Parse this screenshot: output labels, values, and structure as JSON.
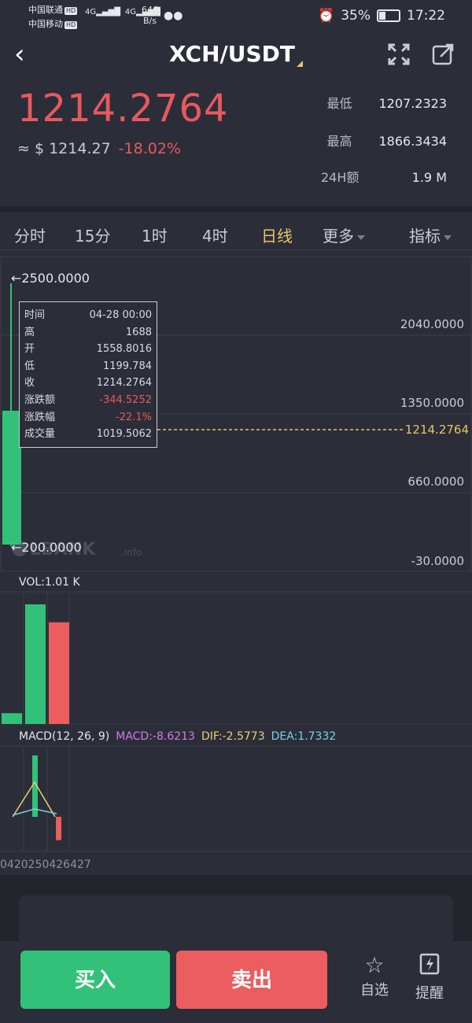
{
  "status": {
    "carrier1": "中国联通",
    "carrier2": "中国移动",
    "hd": "HD",
    "net1": "4G",
    "net2": "4G",
    "speed_value": "646",
    "speed_unit": "B/s",
    "battery_pct": "35%",
    "battery_level": 0.35,
    "time": "17:22"
  },
  "header": {
    "title": "XCH/USDT"
  },
  "price": {
    "last": "1214.2764",
    "approx": "≈ $ 1214.27",
    "change_pct": "-18.02%",
    "low_label": "最低",
    "low": "1207.2323",
    "high_label": "最高",
    "high": "1866.3434",
    "vol24_label": "24H额",
    "vol24": "1.9 M"
  },
  "tabs": [
    "分时",
    "15分",
    "1时",
    "4时",
    "日线",
    "更多",
    "指标"
  ],
  "active_tab": "日线",
  "chart_data": {
    "type": "candlestick",
    "price_axis": {
      "ticks": [
        "2040.0000",
        "1350.0000",
        "660.0000",
        "-30.0000"
      ]
    },
    "high_marker": "←2500.0000",
    "low_marker": "←200.0000",
    "current_price_line": "1214.2764",
    "watermark": "LBANK",
    "watermark_suffix": ".info",
    "candles": [
      {
        "date": "04-28",
        "open": 1558.8016,
        "high": 2500,
        "low": 200,
        "close": 1214.2764
      }
    ],
    "volume": {
      "label": "VOL:1.01 K",
      "bars": [
        {
          "value": 0.09,
          "color": "#33c17a"
        },
        {
          "value": 1.0,
          "color": "#33c17a"
        },
        {
          "value": 0.85,
          "color": "#ec5d5f"
        }
      ]
    },
    "macd": {
      "label": "MACD(12, 26, 9)",
      "macd": "MACD:-8.6213",
      "dif": "DIF:-2.5773",
      "dea": "DEA:1.7332",
      "histogram": [
        {
          "value": 1.0,
          "color": "#33c17a"
        },
        {
          "value": -0.38,
          "color": "#ec5d5f"
        }
      ],
      "colors": {
        "macd": "#d07ae8",
        "dif": "#e8d07a",
        "dea": "#7ad0e8"
      }
    },
    "x_labels": "0420250426427"
  },
  "tooltip": {
    "rows": [
      {
        "label": "时间",
        "value": "04-28 00:00"
      },
      {
        "label": "高",
        "value": "1688"
      },
      {
        "label": "开",
        "value": "1558.8016"
      },
      {
        "label": "低",
        "value": "1199.784"
      },
      {
        "label": "收",
        "value": "1214.2764"
      },
      {
        "label": "涨跌额",
        "value": "-344.5252",
        "red": true
      },
      {
        "label": "涨跌幅",
        "value": "-22.1%",
        "red": true
      },
      {
        "label": "成交量",
        "value": "1019.5062"
      }
    ]
  },
  "footer": {
    "buy": "买入",
    "sell": "卖出",
    "favorite": "自选",
    "alert": "提醒"
  },
  "colors": {
    "up": "#33c17a",
    "down": "#ec5d5f",
    "accent": "#e8c36a",
    "background": "#2b2e38"
  }
}
